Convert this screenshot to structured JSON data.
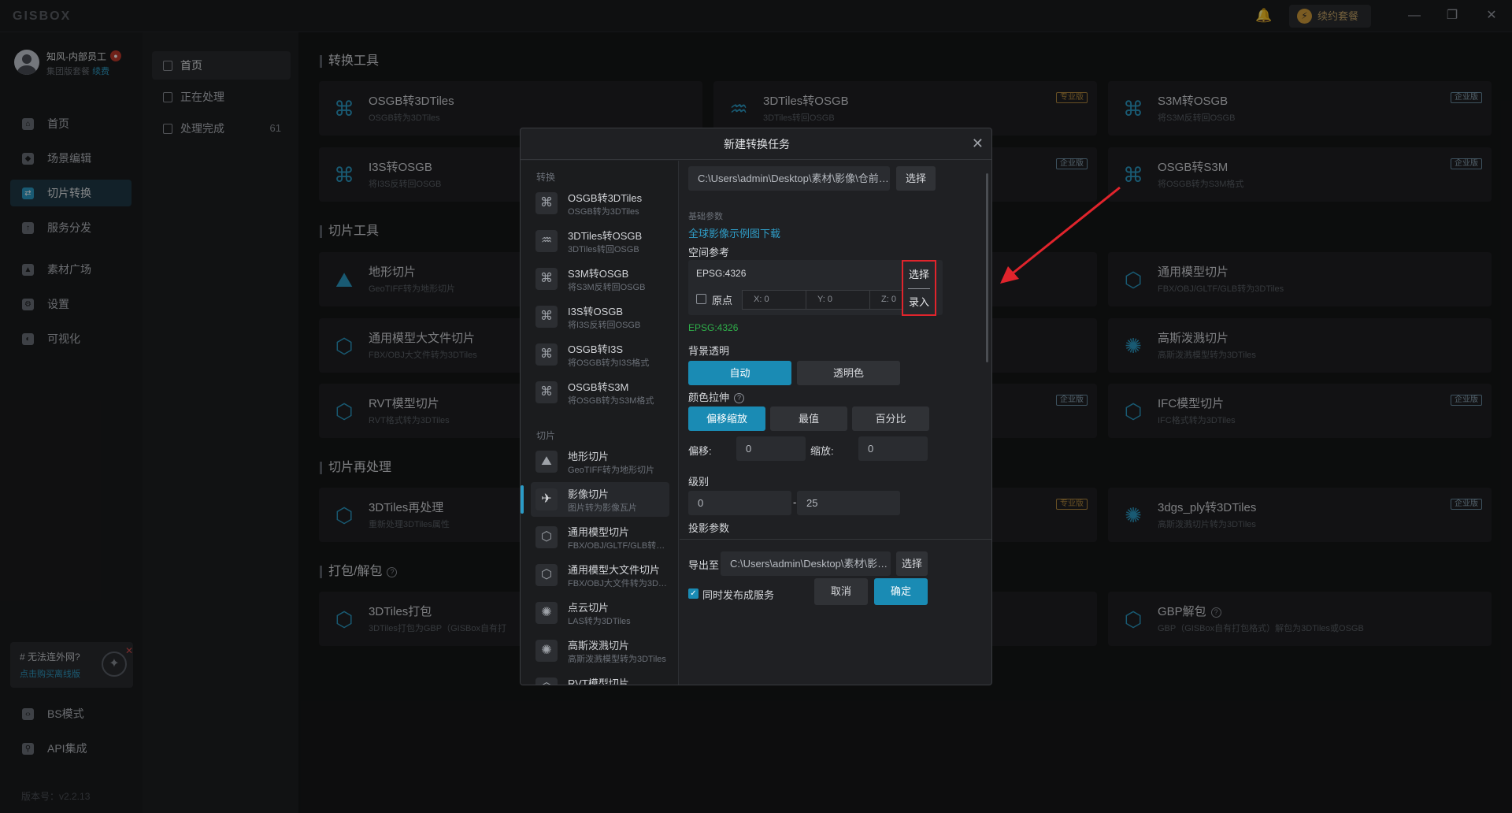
{
  "titlebar": {
    "logo": "GISBOX",
    "renew": "续约套餐",
    "minimize": "—",
    "restore": "❐",
    "close": "✕"
  },
  "user": {
    "name": "知风-内部员工",
    "plan": "集团版套餐",
    "renew": "续费"
  },
  "sidebar": {
    "items": [
      {
        "label": "首页",
        "icon": "home-icon"
      },
      {
        "label": "场景编辑",
        "icon": "cube-icon"
      },
      {
        "label": "切片转换",
        "icon": "convert-icon"
      },
      {
        "label": "服务分发",
        "icon": "upload-icon"
      },
      {
        "label": "素材广场",
        "icon": "image-icon"
      },
      {
        "label": "设置",
        "icon": "gear-icon"
      },
      {
        "label": "可视化",
        "icon": "chart-icon"
      }
    ],
    "bottom": [
      {
        "label": "BS模式",
        "icon": "code-icon"
      },
      {
        "label": "API集成",
        "icon": "api-icon"
      }
    ],
    "promo_title": "# 无法连外网?",
    "promo_link": "点击购买离线版",
    "version": "版本号：v2.2.13"
  },
  "subnav": {
    "items": [
      {
        "label": "首页",
        "count": ""
      },
      {
        "label": "正在处理",
        "count": ""
      },
      {
        "label": "处理完成",
        "count": "61"
      }
    ]
  },
  "sections": {
    "convert": "转换工具",
    "tile": "切片工具",
    "reprocess": "切片再处理",
    "pack": "打包/解包"
  },
  "cards": {
    "c1": {
      "title": "OSGB转3DTiles",
      "sub": "OSGB转为3DTiles"
    },
    "c2": {
      "title": "3DTiles转OSGB",
      "sub": "3DTiles转回OSGB",
      "badge": "专业版"
    },
    "c3": {
      "title": "S3M转OSGB",
      "sub": "将S3M反转回OSGB",
      "badge": "企业版"
    },
    "c4": {
      "title": "I3S转OSGB",
      "sub": "将I3S反转回OSGB"
    },
    "c5": {
      "badge": "企业版"
    },
    "c6": {
      "title": "OSGB转S3M",
      "sub": "将OSGB转为S3M格式",
      "badge": "企业版"
    },
    "c7": {
      "title": "地形切片",
      "sub": "GeoTIFF转为地形切片"
    },
    "c8": {
      "title": "通用模型切片",
      "sub": "FBX/OBJ/GLTF/GLB转为3DTiles"
    },
    "c9": {
      "title": "通用模型大文件切片",
      "sub": "FBX/OBJ大文件转为3DTiles"
    },
    "c10": {
      "title": "高斯泼溅切片",
      "sub": "高斯泼溅模型转为3DTiles"
    },
    "c11": {
      "title": "RVT模型切片",
      "sub": "RVT格式转为3DTiles"
    },
    "c12": {
      "badge": "企业版"
    },
    "c13": {
      "title": "IFC模型切片",
      "sub": "IFC格式转为3DTiles",
      "badge": "企业版"
    },
    "c14": {
      "title": "3DTiles再处理",
      "sub": "重新处理3DTiles属性"
    },
    "c15": {
      "badge": "专业版"
    },
    "c16": {
      "title": "3dgs_ply转3DTiles",
      "sub": "高斯泼溅切片转为3DTiles",
      "badge": "企业版"
    },
    "c17": {
      "title": "3DTiles打包",
      "sub": "3DTiles打包为GBP（GISBox自有打"
    },
    "c18": {
      "title": "GBP解包",
      "sub": "GBP（GISBox自有打包格式）解包为3DTiles或OSGB"
    }
  },
  "dialog": {
    "title": "新建转换任务",
    "group_convert": "转换",
    "group_tile": "切片",
    "items": [
      {
        "title": "OSGB转3DTiles",
        "sub": "OSGB转为3DTiles"
      },
      {
        "title": "3DTiles转OSGB",
        "sub": "3DTiles转回OSGB"
      },
      {
        "title": "S3M转OSGB",
        "sub": "将S3M反转回OSGB"
      },
      {
        "title": "I3S转OSGB",
        "sub": "将I3S反转回OSGB"
      },
      {
        "title": "OSGB转I3S",
        "sub": "将OSGB转为I3S格式"
      },
      {
        "title": "OSGB转S3M",
        "sub": "将OSGB转为S3M格式"
      },
      {
        "title": "地形切片",
        "sub": "GeoTIFF转为地形切片"
      },
      {
        "title": "影像切片",
        "sub": "图片转为影像瓦片"
      },
      {
        "title": "通用模型切片",
        "sub": "FBX/OBJ/GLTF/GLB转为3DTiles"
      },
      {
        "title": "通用模型大文件切片",
        "sub": "FBX/OBJ大文件转为3DTiles"
      },
      {
        "title": "点云切片",
        "sub": "LAS转为3DTiles"
      },
      {
        "title": "高斯泼溅切片",
        "sub": "高斯泼溅模型转为3DTiles"
      },
      {
        "title": "RVT模型切片",
        "sub": ""
      }
    ],
    "input_path": "C:\\Users\\admin\\Desktop\\素材\\影像\\仓前街道_…",
    "select": "选择",
    "basic_params": "基础参数",
    "sample_link": "全球影像示例图下载",
    "spatial_ref": "空间参考",
    "epsg": "EPSG:4326",
    "origin": "原点",
    "x": "X: 0",
    "y": "Y: 0",
    "z": "Z: 0",
    "choose": "选择",
    "enter": "录入",
    "epsg_green": "EPSG:4326",
    "bg_transparent": "背景透明",
    "auto": "自动",
    "transparent_color": "透明色",
    "color_stretch": "颜色拉伸",
    "stretch_options": [
      "偏移缩放",
      "最值",
      "百分比"
    ],
    "offset_label": "偏移:",
    "offset_value": "0",
    "scale_label": "缩放:",
    "scale_value": "0",
    "level": "级别",
    "level_min": "0",
    "level_dash": "-",
    "level_max": "25",
    "projection": "投影参数",
    "export_label": "导出至",
    "export_path": "C:\\Users\\admin\\Desktop\\素材\\影像\\out…",
    "export_select": "选择",
    "publish": "同时发布成服务",
    "cancel": "取消",
    "confirm": "确定"
  },
  "colors": {
    "accent": "#1a8bb4",
    "highlight": "#e0242c"
  }
}
